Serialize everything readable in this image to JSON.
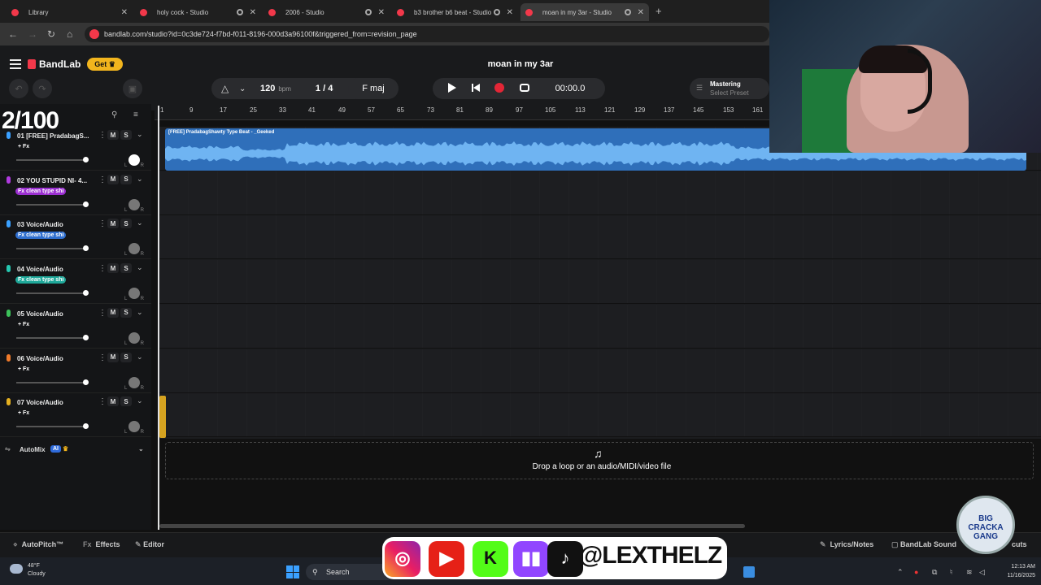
{
  "browser": {
    "tabs": [
      {
        "title": "Library"
      },
      {
        "title": "holy cock - Studio"
      },
      {
        "title": "2006 - Studio"
      },
      {
        "title": "b3 brother b6 beat - Studio"
      },
      {
        "title": "moan in my 3ar - Studio"
      }
    ],
    "new_tab": "+",
    "url": "bandlab.com/studio?id=0c3de724-f7bd-f011-8196-000d3a96100f&triggered_from=revision_page",
    "back": "←",
    "forward": "→",
    "reload": "↻",
    "home": "⌂"
  },
  "app": {
    "brand": "BandLab",
    "get_label": "Get",
    "project_title": "moan in my 3ar",
    "tempo": "120",
    "tempo_unit": "bpm",
    "time_signature": "1 / 4",
    "key": "F maj",
    "time": "00:00.0",
    "mastering_title": "Mastering",
    "mastering_preset": "Select Preset"
  },
  "overlay_counter": "2/100",
  "ruler": {
    "ticks": [
      "1",
      "9",
      "17",
      "25",
      "33",
      "41",
      "49",
      "57",
      "65",
      "73",
      "81",
      "89",
      "97",
      "105",
      "113",
      "121",
      "129",
      "137",
      "145",
      "153",
      "161"
    ]
  },
  "tracks": [
    {
      "name": "01  [FREE] PradabagS...",
      "fx": "+ Fx",
      "color": "#3aa0ff",
      "fx_bg": "transparent"
    },
    {
      "name": "02  YOU STUPID NI- 4...",
      "fx": "Fx clean type shi",
      "color": "#b03adf",
      "fx_bg": "#9b2fd1"
    },
    {
      "name": "03  Voice/Audio",
      "fx": "Fx clean type shi",
      "color": "#3aa0ff",
      "fx_bg": "#2f6fd0"
    },
    {
      "name": "04  Voice/Audio",
      "fx": "Fx clean type shi",
      "color": "#25c6b0",
      "fx_bg": "#1fa89a"
    },
    {
      "name": "05  Voice/Audio",
      "fx": "+ Fx",
      "color": "#3cc25a",
      "fx_bg": "transparent"
    },
    {
      "name": "06  Voice/Audio",
      "fx": "+ Fx",
      "color": "#f07a2a",
      "fx_bg": "transparent"
    },
    {
      "name": "07  Voice/Audio",
      "fx": "+ Fx",
      "color": "#e5b020",
      "fx_bg": "transparent"
    }
  ],
  "track_controls": {
    "mute": "M",
    "solo": "S",
    "dots": "⋮",
    "chevron": "⌄",
    "left": "L",
    "right": "R"
  },
  "automix": {
    "label": "AutoMix",
    "ai": "AI"
  },
  "clip1_label": "[FREE] PradabagShawty Type Beat - _Geeked",
  "drop": {
    "icon": "♫",
    "text": "Drop a loop or an audio/MIDI/video file"
  },
  "bottom": {
    "autopitch": "AutoPitch™",
    "effects": "Effects",
    "editor": "Editor",
    "lyrics": "Lyrics/Notes",
    "sounds": "BandLab Sound",
    "shortcuts": "cuts"
  },
  "taskbar": {
    "temp": "48°F",
    "condition": "Cloudy",
    "search": "Search",
    "time": "12:13 AM",
    "date": "11/16/2025"
  },
  "social": {
    "handle": "@LEXTHELZ"
  },
  "badge": {
    "line1": "BIG",
    "line2": "CRACKA",
    "line3": "GANG"
  }
}
